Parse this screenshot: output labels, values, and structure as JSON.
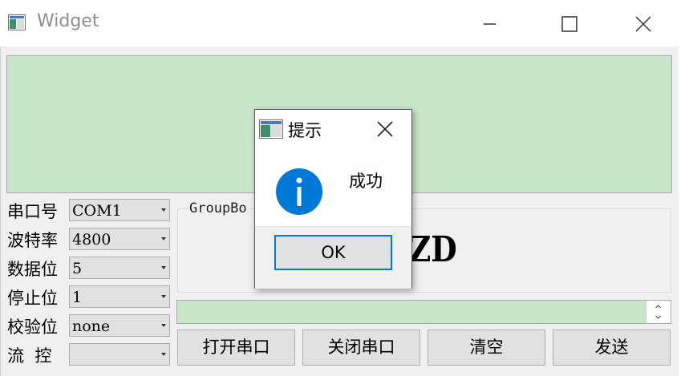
{
  "window": {
    "title": "Widget"
  },
  "receive_area": {
    "text": ""
  },
  "settings": {
    "port": {
      "label": "串口号",
      "value": "COM1"
    },
    "baud": {
      "label": "波特率",
      "value": "4800"
    },
    "databits": {
      "label": "数据位",
      "value": "5"
    },
    "stopbits": {
      "label": "停止位",
      "value": "1"
    },
    "parity": {
      "label": "校验位",
      "value": "none"
    },
    "flow": {
      "label": "流  控",
      "value": ""
    }
  },
  "group": {
    "title": "GroupBo",
    "big_text": "ZD"
  },
  "send_area": {
    "text": ""
  },
  "buttons": {
    "open": "打开串口",
    "close": "关闭串口",
    "clear": "清空",
    "send": "发送"
  },
  "dialog": {
    "title": "提示",
    "message": "成功",
    "ok": "OK"
  },
  "colors": {
    "accent": "#0078d7",
    "text_area_bg": "#c8e6c9",
    "info_icon": "#0078d7"
  }
}
